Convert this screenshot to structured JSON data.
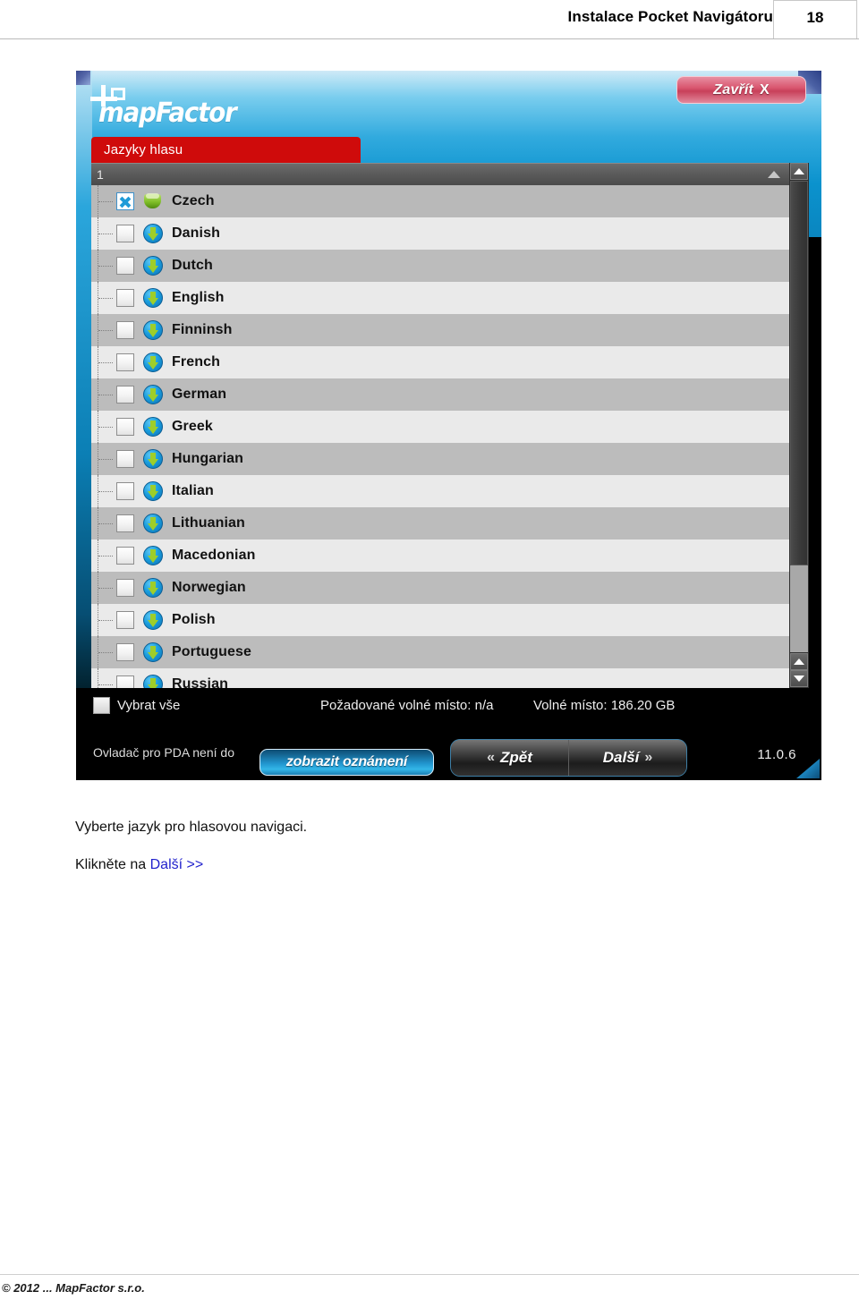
{
  "page": {
    "header_title": "Instalace Pocket Navigátoru",
    "page_number": "18",
    "footer": "© 2012 ... MapFactor s.r.o."
  },
  "caption": {
    "line1": "Vyberte jazyk pro hlasovou navigaci.",
    "line2_prefix": "Klikněte na ",
    "line2_link": "Další >>"
  },
  "app": {
    "brand": "mapFactor",
    "close_button": {
      "label": "Zavřít",
      "icon": "X"
    },
    "tab_label": "Jazyky hlasu",
    "column_header": "1",
    "version": "11.0.6",
    "colors": {
      "tab_red": "#cf0b0b",
      "sky_top": "#cfeaf7",
      "sky_bottom": "#0a86c0",
      "checkbox_check": "#1f9bd8",
      "download_badge": "#1a9ede",
      "installed_badge": "#7fbe27"
    },
    "languages": [
      {
        "name": "Czech",
        "checked": true,
        "status_icon": "installed-shield-icon"
      },
      {
        "name": "Danish",
        "checked": false,
        "status_icon": "download-icon"
      },
      {
        "name": "Dutch",
        "checked": false,
        "status_icon": "download-icon"
      },
      {
        "name": "English",
        "checked": false,
        "status_icon": "download-icon"
      },
      {
        "name": "Finninsh",
        "checked": false,
        "status_icon": "download-icon"
      },
      {
        "name": "French",
        "checked": false,
        "status_icon": "download-icon"
      },
      {
        "name": "German",
        "checked": false,
        "status_icon": "download-icon"
      },
      {
        "name": "Greek",
        "checked": false,
        "status_icon": "download-icon"
      },
      {
        "name": "Hungarian",
        "checked": false,
        "status_icon": "download-icon"
      },
      {
        "name": "Italian",
        "checked": false,
        "status_icon": "download-icon"
      },
      {
        "name": "Lithuanian",
        "checked": false,
        "status_icon": "download-icon"
      },
      {
        "name": "Macedonian",
        "checked": false,
        "status_icon": "download-icon"
      },
      {
        "name": "Norwegian",
        "checked": false,
        "status_icon": "download-icon"
      },
      {
        "name": "Polish",
        "checked": false,
        "status_icon": "download-icon"
      },
      {
        "name": "Portuguese",
        "checked": false,
        "status_icon": "download-icon"
      },
      {
        "name": "Russian",
        "checked": false,
        "status_icon": "download-icon"
      }
    ],
    "status_bar": {
      "select_all_label": "Vybrat vše",
      "required_space": "Požadované volné místo: n/a",
      "free_space": "Volné místo: 186.20 GB"
    },
    "toolbar": {
      "message": "Ovladač pro PDA není do",
      "notify_label": "zobrazit oznámení",
      "back_label": "Zpět",
      "back_chevron": "«",
      "next_label": "Další",
      "next_chevron": "»"
    }
  }
}
